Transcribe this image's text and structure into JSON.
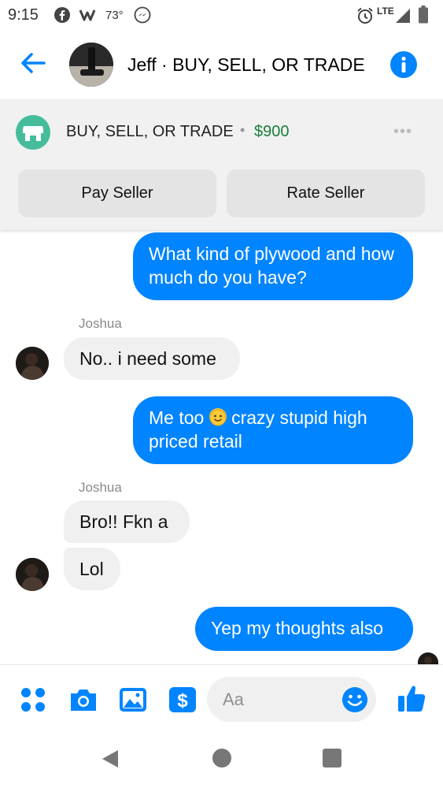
{
  "status_bar": {
    "time": "9:15",
    "temperature": "73°",
    "network": "LTE",
    "icons": [
      "facebook-icon",
      "weather-icon",
      "messenger-icon",
      "alarm-icon",
      "signal-icon",
      "battery-icon"
    ]
  },
  "header": {
    "title": "Jeff · BUY, SELL, OR TRADE",
    "back_icon": "back-arrow-icon",
    "info_icon": "info-icon"
  },
  "marketplace": {
    "listing_title": "BUY, SELL, OR TRADE",
    "separator": "•",
    "price": "$900",
    "more_label": "•••",
    "pay_button": "Pay Seller",
    "rate_button": "Rate Seller"
  },
  "messages": [
    {
      "direction": "outgoing",
      "text": "What kind of plywood and how much do you have?"
    },
    {
      "direction": "incoming",
      "sender": "Joshua",
      "text": "No.. i need some"
    },
    {
      "direction": "outgoing",
      "text_before_emoji": "Me too ",
      "emoji": "slightly-smiling-face",
      "text_after_emoji": " crazy stupid high priced retail"
    },
    {
      "direction": "incoming",
      "sender": "Joshua",
      "text": "Bro!!  Fkn a"
    },
    {
      "direction": "incoming",
      "text": "Lol"
    },
    {
      "direction": "outgoing",
      "text": "Yep my thoughts also"
    }
  ],
  "composer": {
    "placeholder": "Aa",
    "icons": [
      "more-icon",
      "camera-icon",
      "gallery-icon",
      "payment-icon",
      "emoji-icon",
      "like-icon"
    ]
  },
  "colors": {
    "accent": "#0084ff",
    "price_green": "#1a7f37",
    "store_icon": "#45bd9b",
    "incoming_bubble": "#f0f0f0"
  }
}
